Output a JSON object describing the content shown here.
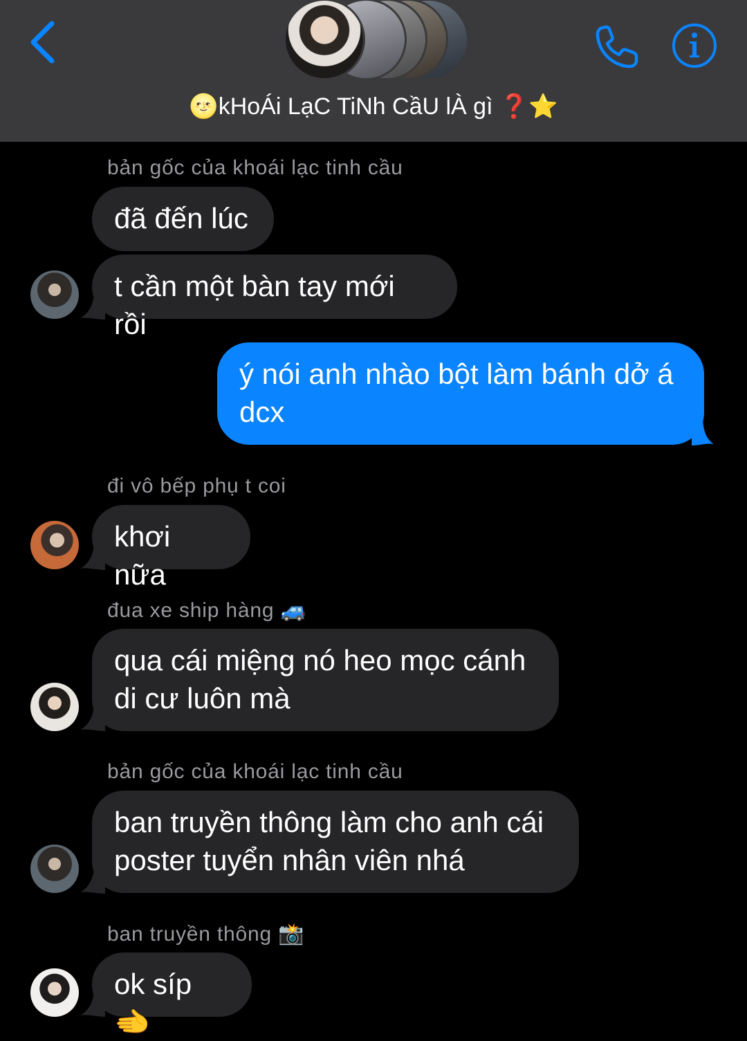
{
  "header": {
    "title_emoji": "🌝",
    "title": "kHoÁi LạC TiNh CầU lÀ gì",
    "title_suffix_emoji": "❓⭐",
    "back_icon": "chevron-left-icon",
    "call_icon": "phone-icon",
    "info_icon": "info-icon",
    "accent_color": "#0a84ff"
  },
  "messages": [
    {
      "sender": "bản gốc của khoái lạc tinh cầu",
      "text": "đã đến lúc",
      "direction": "incoming"
    },
    {
      "text": "t cần một bàn tay mới rồi",
      "direction": "incoming"
    },
    {
      "text": "ý nói anh nhào bột làm bánh dở á\ndcx",
      "direction": "outgoing"
    },
    {
      "sender": "đi vô bếp phụ t coi",
      "text": "khơi nữa",
      "direction": "incoming"
    },
    {
      "sender": "đua xe ship hàng 🚙",
      "text": "qua cái miệng nó heo mọc cánh\ndi cư luôn mà",
      "direction": "incoming"
    },
    {
      "sender": "bản gốc của khoái lạc tinh cầu",
      "text": "ban truyền thông làm cho anh cái\nposter tuyển nhân viên nhá",
      "direction": "incoming"
    },
    {
      "sender": "ban truyền thông 📸",
      "text": "ok síp 🫲",
      "direction": "incoming"
    }
  ]
}
